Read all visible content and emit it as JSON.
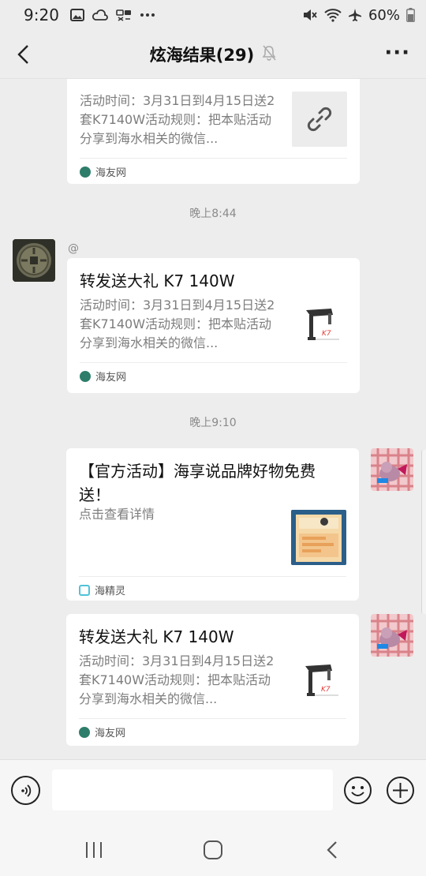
{
  "status_bar": {
    "time": "9:20",
    "battery": "60%",
    "left_icons": [
      "image-icon",
      "cloud-icon",
      "nfc-icon",
      "more-dots-icon"
    ],
    "right_icons": [
      "mute-icon",
      "wifi-icon",
      "airplane-icon",
      "battery-icon"
    ]
  },
  "nav": {
    "title": "炫海结果(29)",
    "back_icon": "back-chevron-icon",
    "mute_icon": "bell-muted-icon",
    "more_label": "···"
  },
  "chat": {
    "messages": [
      {
        "title": "",
        "desc": "活动时间：3月31日到4月15日送2套K7140W活动规则：把本贴活动分享到海水相关的微信...",
        "source": "海友网",
        "thumb": "link-icon"
      },
      {
        "time": "晚上8:44",
        "sender": "@",
        "title": "转发送大礼 K7 140W",
        "desc": "活动时间：3月31日到4月15日送2套K7140W活动规则：把本贴活动分享到海水相关的微信...",
        "source": "海友网",
        "thumb": "lamp-thumbnail"
      },
      {
        "time": "晚上9:10",
        "title": "【官方活动】海享说品牌好物免费送！",
        "desc": "点击查看详情",
        "source": "海精灵",
        "thumb": "product-thumbnail"
      },
      {
        "title": "转发送大礼 K7 140W",
        "desc": "活动时间：3月31日到4月15日送2套K7140W活动规则：把本贴活动分享到海水相关的微信...",
        "source": "海友网",
        "thumb": "lamp-thumbnail"
      }
    ]
  },
  "input_bar": {
    "placeholder": "",
    "voice_icon": "voice-icon",
    "emoji_icon": "emoji-icon",
    "plus_icon": "plus-icon"
  },
  "colors": {
    "background": "#ededed",
    "card": "#ffffff",
    "muted_text": "#7d7d7d",
    "brand_blue": "#1565c0"
  }
}
